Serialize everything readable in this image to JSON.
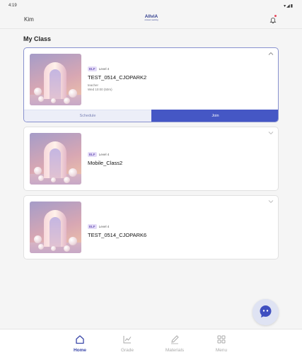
{
  "status_bar": {
    "time": "4:19",
    "icons": "▾◢▮"
  },
  "header": {
    "user_name": "Kim",
    "logo_main": "AllviA",
    "logo_sub": "connect, learning",
    "colors": {
      "accent": "#2d3a8c",
      "notification_dot": "#e5475b"
    }
  },
  "section": {
    "title": "My Class"
  },
  "classes": [
    {
      "badge": "ELF",
      "level": "Level 4",
      "name": "TEST_0514_CJOPARK2",
      "teacher": "teacher",
      "schedule_time": "Wed 10:00 (50m)",
      "expanded": true,
      "schedule_label": "Schedule",
      "join_label": "Join"
    },
    {
      "badge": "ELF",
      "level": "Level 4",
      "name": "Mobile_Class2",
      "expanded": false
    },
    {
      "badge": "ELF",
      "level": "Level 4",
      "name": "TEST_0514_CJOPARK6",
      "expanded": false
    }
  ],
  "bottom_nav": {
    "items": [
      {
        "label": "Home",
        "icon": "home-icon",
        "selected": true
      },
      {
        "label": "Grade",
        "icon": "chart-icon",
        "selected": false
      },
      {
        "label": "Materials",
        "icon": "pencil-icon",
        "selected": false
      },
      {
        "label": "Menu",
        "icon": "grid-icon",
        "selected": false
      }
    ],
    "colors": {
      "selected": "#3946a8",
      "unselected": "#aaaaaa"
    }
  },
  "colors": {
    "join_button": "#4557c5",
    "schedule_button": "#eceef8",
    "badge_bg": "#e4dcf7",
    "badge_text": "#6c56b8"
  }
}
